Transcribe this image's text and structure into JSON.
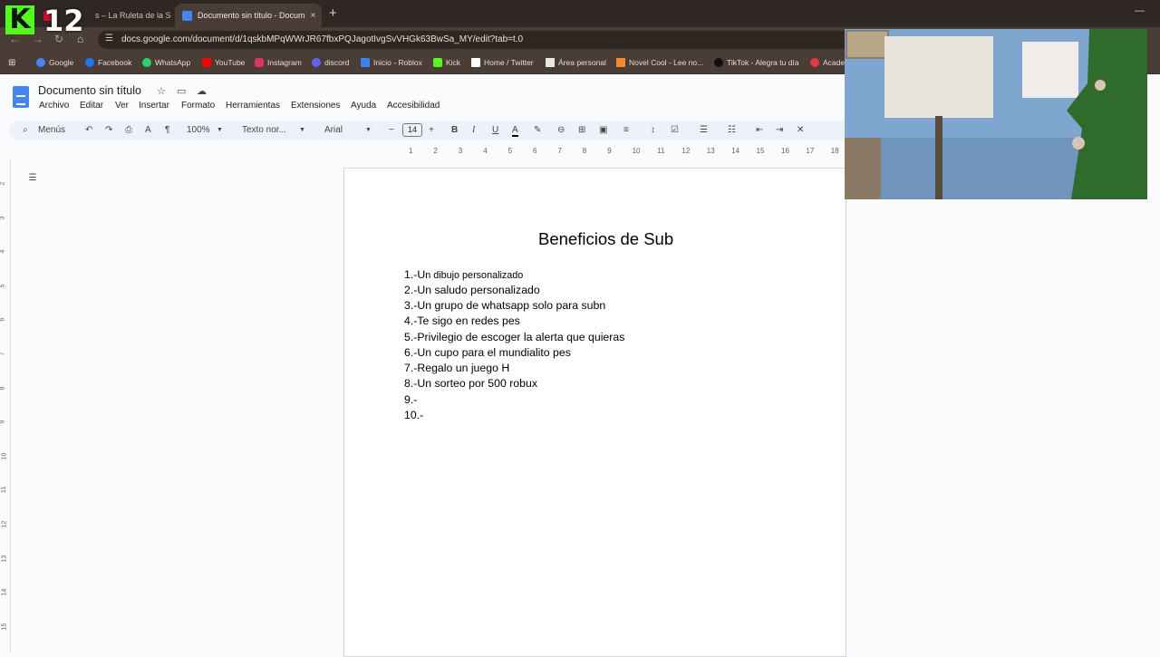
{
  "browser": {
    "tabs": [
      {
        "label": "s – La Ruleta de la S",
        "close": "×",
        "active": false,
        "favicon_color": "#c8102e"
      },
      {
        "label": "Documento sin título - Docum",
        "close": "×",
        "active": true,
        "favicon_color": "#4285f4"
      }
    ],
    "new_tab": "+",
    "minimize": "—",
    "url": "docs.google.com/document/d/1qskbMPqWWrJR67fbxPQJagotIvgSvVHGk63BwSa_MY/edit?tab=t.0",
    "bookmarks": [
      {
        "label": "Google",
        "color": "#4285f4"
      },
      {
        "label": "Facebook",
        "color": "#1877f2"
      },
      {
        "label": "WhatsApp",
        "color": "#25d366"
      },
      {
        "label": "YouTube",
        "color": "#ff0000"
      },
      {
        "label": "Instagram",
        "color": "#e1306c"
      },
      {
        "label": "discord",
        "color": "#5865f2"
      },
      {
        "label": "Inicio - Roblox",
        "color": "#3b82f6"
      },
      {
        "label": "Kick",
        "color": "#53fc18"
      },
      {
        "label": "Home / Twitter",
        "color": "#ffffff"
      },
      {
        "label": "Área personal",
        "color": "#e8e8e8"
      },
      {
        "label": "Novel Cool - Lee no...",
        "color": "#f28c28"
      },
      {
        "label": "TikTok - Alegra tu día",
        "color": "#111111"
      },
      {
        "label": "Acade",
        "color": "#e53935"
      }
    ]
  },
  "overlay": {
    "logo_letter": "K",
    "count": "12"
  },
  "docs": {
    "title": "Documento sin título",
    "menu": [
      "Archivo",
      "Editar",
      "Ver",
      "Insertar",
      "Formato",
      "Herramientas",
      "Extensiones",
      "Ayuda",
      "Accesibilidad"
    ],
    "toolbar": {
      "search": "Menús",
      "zoom": "100%",
      "style": "Texto nor...",
      "font": "Arial",
      "font_size": "14"
    },
    "ruler_numbers": [
      "1",
      "2",
      "3",
      "4",
      "5",
      "6",
      "7",
      "8",
      "9",
      "10",
      "11",
      "12",
      "13",
      "14",
      "15",
      "16",
      "17",
      "18"
    ],
    "left_ruler_numbers": [
      "2",
      "3",
      "4",
      "5",
      "6",
      "7",
      "8",
      "9",
      "10",
      "11",
      "12",
      "13",
      "14",
      "15"
    ]
  },
  "document": {
    "heading": "Beneficios de Sub",
    "lines": [
      {
        "prefix": "1.-U",
        "rest": "n dibujo personalizado"
      },
      {
        "prefix": "2.-Un saludo personalizado",
        "rest": ""
      },
      {
        "prefix": "3.-Un grupo de whatsapp solo para subn",
        "rest": ""
      },
      {
        "prefix": "4.-Te sigo en redes pes",
        "rest": ""
      },
      {
        "prefix": "5.-Privilegio de escoger la alerta que quieras",
        "rest": ""
      },
      {
        "prefix": "6.-Un cupo para el mundialito pes",
        "rest": ""
      },
      {
        "prefix": "7.-Regalo un juego H",
        "rest": ""
      },
      {
        "prefix": "8.-Un sorteo por 500 robux",
        "rest": ""
      },
      {
        "prefix": "9.-",
        "rest": ""
      },
      {
        "prefix": "10.-",
        "rest": ""
      }
    ]
  }
}
